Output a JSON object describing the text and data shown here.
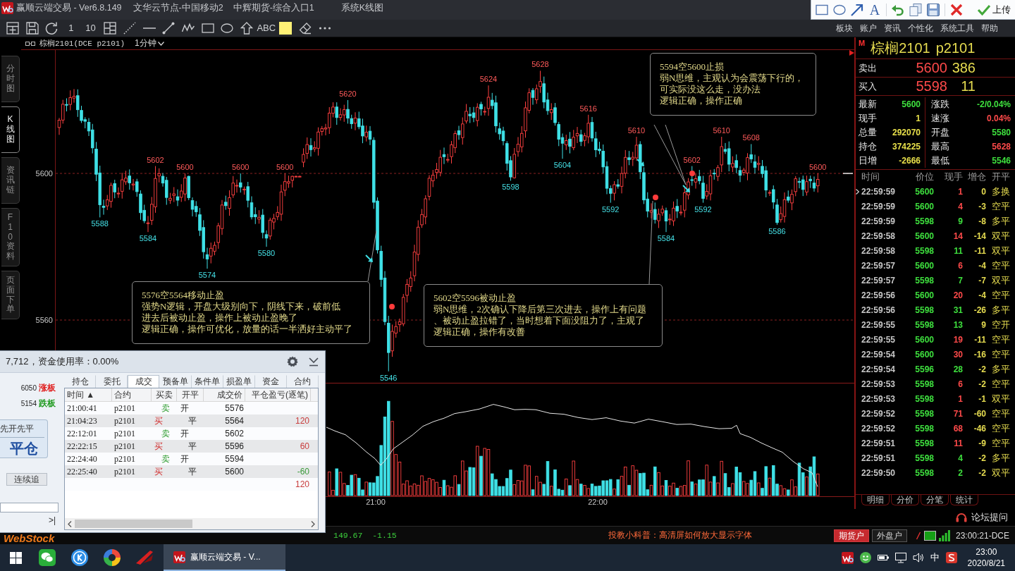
{
  "title_bar": {
    "title": "赢顺云端交易 - Ver6.8.149",
    "items": [
      "文华云节点-中国移动2",
      "中辉期货-综合入口1",
      "系统K线图"
    ]
  },
  "snip_toolbar": {
    "tools": [
      {
        "kind": "rectangle"
      },
      {
        "kind": "ellipse"
      },
      {
        "kind": "arrow"
      },
      {
        "kind": "text",
        "label": "A"
      },
      {
        "kind": "undo"
      },
      {
        "kind": "copy"
      },
      {
        "kind": "save"
      },
      {
        "kind": "close"
      },
      {
        "kind": "upload",
        "label": "上传"
      }
    ]
  },
  "toolbar": {
    "tools": [
      {
        "kind": "frame"
      },
      {
        "kind": "save"
      },
      {
        "kind": "refresh"
      },
      {
        "kind": "text",
        "label": "1"
      },
      {
        "kind": "text",
        "label": "10"
      },
      {
        "kind": "layout"
      },
      {
        "kind": "dotted-line"
      },
      {
        "kind": "horizontal-line"
      },
      {
        "kind": "segment"
      },
      {
        "kind": "wave"
      },
      {
        "kind": "rectangle"
      },
      {
        "kind": "ellipse"
      },
      {
        "kind": "up-arrow"
      },
      {
        "kind": "text",
        "label": "ABC"
      },
      {
        "kind": "swatch",
        "color": "#fff176"
      },
      {
        "kind": "eraser"
      },
      {
        "kind": "more"
      }
    ],
    "menu": [
      "板块",
      "账户",
      "资讯",
      "个性化",
      "系统工具",
      "帮助"
    ]
  },
  "side_tabs": [
    {
      "label": "分时图",
      "selected": false
    },
    {
      "label": "K线图",
      "selected": true
    },
    {
      "label": "资讯链",
      "selected": false
    },
    {
      "label": "F10资料",
      "selected": false
    },
    {
      "label": "页面下单",
      "selected": false
    }
  ],
  "chart": {
    "symbol": "棕榈2101(DCE p2101)",
    "period": "1分钟",
    "y_labels": [
      "5600",
      "5560"
    ],
    "time_labels": [
      "21:00",
      "22:00"
    ],
    "price_labels": [
      {
        "text": "5588",
        "kind": "low"
      },
      {
        "text": "5584",
        "kind": "low"
      },
      {
        "text": "5602",
        "kind": "high"
      },
      {
        "text": "5600",
        "kind": "high"
      },
      {
        "text": "5574",
        "kind": "low"
      },
      {
        "text": "5600",
        "kind": "high"
      },
      {
        "text": "5580",
        "kind": "low"
      },
      {
        "text": "5600",
        "kind": "high"
      },
      {
        "text": "5620",
        "kind": "high"
      },
      {
        "text": "5546",
        "kind": "low"
      },
      {
        "text": "5624",
        "kind": "high"
      },
      {
        "text": "5598",
        "kind": "low"
      },
      {
        "text": "5628",
        "kind": "high"
      },
      {
        "text": "5604",
        "kind": "low"
      },
      {
        "text": "5616",
        "kind": "high"
      },
      {
        "text": "5592",
        "kind": "low"
      },
      {
        "text": "5610",
        "kind": "high"
      },
      {
        "text": "5584",
        "kind": "low"
      },
      {
        "text": "5602",
        "kind": "high"
      },
      {
        "text": "5592",
        "kind": "low"
      },
      {
        "text": "5610",
        "kind": "high"
      },
      {
        "text": "5608",
        "kind": "high"
      },
      {
        "text": "5586",
        "kind": "low"
      },
      {
        "text": "5600",
        "kind": "high"
      }
    ],
    "markers": [
      {
        "kind": "arrow"
      },
      {
        "kind": "dot"
      },
      {
        "kind": "arrow"
      },
      {
        "kind": "dot"
      },
      {
        "kind": "arrow"
      },
      {
        "kind": "dot"
      }
    ],
    "notes": [
      {
        "lines": [
          "5576空5564移动止盈",
          "强势N逻辑，开盘大级别向下，阴线下来，破前低",
          "进去后被动止盈，操作上被动止盈晚了",
          "逻辑正确，操作可优化，放量的话一半洒好主动平了"
        ]
      },
      {
        "lines": [
          "5602空5596被动止盈",
          "弱N思维，2次确认下降后第三次进去，操作上有问题",
          "、被动止盈拉错了，当时想着下面没阻力了，主观了",
          "逻辑正确，操作有改善"
        ]
      },
      {
        "lines": [
          "5594空5600止损",
          "弱N思维，主观认为会震荡下行的，",
          "可实际没这么走，没办法",
          "逻辑正确，操作正确"
        ]
      }
    ]
  },
  "quote": {
    "badge": "M",
    "name": "棕榈2101",
    "code": "p2101",
    "ask": {
      "label": "卖出",
      "price": "5600",
      "volume": "386"
    },
    "bid": {
      "label": "买入",
      "price": "5598",
      "volume": "11"
    },
    "stats": [
      {
        "label": "最新",
        "value": "5600",
        "color": "#3ee03e"
      },
      {
        "label": "涨跌",
        "value": "-2/0.04%",
        "color": "#3ee03e"
      },
      {
        "label": "现手",
        "value": "1",
        "color": "#e8e04a"
      },
      {
        "label": "速涨",
        "value": "0.04%",
        "color": "#ff4a4a"
      },
      {
        "label": "总量",
        "value": "292070",
        "color": "#e8e04a"
      },
      {
        "label": "开盘",
        "value": "5580",
        "color": "#3ee03e"
      },
      {
        "label": "持仓",
        "value": "374225",
        "color": "#e8e04a"
      },
      {
        "label": "最高",
        "value": "5628",
        "color": "#ff4a4a"
      },
      {
        "label": "日增",
        "value": "-2666",
        "color": "#e8e04a"
      },
      {
        "label": "最低",
        "value": "5546",
        "color": "#3ee03e"
      }
    ]
  },
  "ticks": {
    "columns": [
      "时间",
      "价位",
      "现手",
      "增仓",
      "开平"
    ],
    "rows": [
      {
        "time": "22:59:59",
        "price": "5600",
        "volume": "1",
        "color": "#ff4a4a",
        "change": "0",
        "type": "多换",
        "current": true
      },
      {
        "time": "22:59:59",
        "price": "5600",
        "volume": "4",
        "color": "#ff4a4a",
        "change": "-3",
        "type": "空平",
        "current": false
      },
      {
        "time": "22:59:59",
        "price": "5598",
        "volume": "9",
        "color": "#3ee03e",
        "change": "-8",
        "type": "多平",
        "current": false
      },
      {
        "time": "22:59:58",
        "price": "5600",
        "volume": "14",
        "color": "#ff4a4a",
        "change": "-14",
        "type": "双平",
        "current": false
      },
      {
        "time": "22:59:58",
        "price": "5598",
        "volume": "11",
        "color": "#3ee03e",
        "change": "-11",
        "type": "双平",
        "current": false
      },
      {
        "time": "22:59:57",
        "price": "5600",
        "volume": "6",
        "color": "#ff4a4a",
        "change": "-4",
        "type": "空平",
        "current": false
      },
      {
        "time": "22:59:57",
        "price": "5598",
        "volume": "7",
        "color": "#3ee03e",
        "change": "-7",
        "type": "双平",
        "current": false
      },
      {
        "time": "22:59:56",
        "price": "5600",
        "volume": "20",
        "color": "#ff4a4a",
        "change": "-4",
        "type": "空平",
        "current": false
      },
      {
        "time": "22:59:56",
        "price": "5598",
        "volume": "31",
        "color": "#3ee03e",
        "change": "-26",
        "type": "多平",
        "current": false
      },
      {
        "time": "22:59:55",
        "price": "5598",
        "volume": "13",
        "color": "#3ee03e",
        "change": "9",
        "type": "空开",
        "current": false
      },
      {
        "time": "22:59:55",
        "price": "5600",
        "volume": "19",
        "color": "#ff4a4a",
        "change": "-11",
        "type": "空平",
        "current": false
      },
      {
        "time": "22:59:54",
        "price": "5600",
        "volume": "30",
        "color": "#ff4a4a",
        "change": "-16",
        "type": "空平",
        "current": false
      },
      {
        "time": "22:59:54",
        "price": "5596",
        "volume": "28",
        "color": "#3ee03e",
        "change": "-2",
        "type": "多平",
        "current": false
      },
      {
        "time": "22:59:53",
        "price": "5598",
        "volume": "6",
        "color": "#ff4a4a",
        "change": "-2",
        "type": "空平",
        "current": false
      },
      {
        "time": "22:59:53",
        "price": "5598",
        "volume": "1",
        "color": "#ff4a4a",
        "change": "-1",
        "type": "双平",
        "current": false
      },
      {
        "time": "22:59:52",
        "price": "5598",
        "volume": "71",
        "color": "#ff4a4a",
        "change": "-60",
        "type": "空平",
        "current": false
      },
      {
        "time": "22:59:52",
        "price": "5598",
        "volume": "68",
        "color": "#ff4a4a",
        "change": "-46",
        "type": "空平",
        "current": false
      },
      {
        "time": "22:59:51",
        "price": "5598",
        "volume": "11",
        "color": "#ff4a4a",
        "change": "-9",
        "type": "空平",
        "current": false
      },
      {
        "time": "22:59:51",
        "price": "5598",
        "volume": "4",
        "color": "#3ee03e",
        "change": "-2",
        "type": "多平",
        "current": false
      },
      {
        "time": "22:59:50",
        "price": "5598",
        "volume": "2",
        "color": "#3ee03e",
        "change": "-2",
        "type": "双平",
        "current": false
      }
    ]
  },
  "tick_tabs": [
    "明细",
    "分价",
    "分笔",
    "统计"
  ],
  "forum_link": "论坛提问",
  "order_window": {
    "summary": "7,712，资金使用率：0.00%",
    "limits": [
      {
        "price": "6050",
        "label": "涨板",
        "color": "#e02020"
      },
      {
        "price": "5154",
        "label": "跌板",
        "color": "#1e9a1e"
      }
    ],
    "mode": "先开先平",
    "action": "平仓",
    "chase_button": "连续追",
    "end_button": ">|",
    "tabs": [
      {
        "label": "持仓",
        "selected": false
      },
      {
        "label": "委托",
        "selected": false
      },
      {
        "label": "成交",
        "selected": true
      },
      {
        "label": "预备单",
        "selected": false
      },
      {
        "label": "条件单",
        "selected": false
      },
      {
        "label": "损盈单",
        "selected": false
      },
      {
        "label": "资金",
        "selected": false
      },
      {
        "label": "合约",
        "selected": false
      }
    ],
    "columns": [
      "时间 ▲",
      "合约",
      "买卖",
      "开平",
      "成交价",
      "平仓盈亏(逐笔)"
    ],
    "rows": [
      {
        "time": "21:00:41",
        "contract": "p2101",
        "side": {
          "label": "卖",
          "kind": "sell"
        },
        "offset": {
          "label": "开",
          "kind": "open"
        },
        "price": "5576"
      },
      {
        "time": "21:04:23",
        "contract": "p2101",
        "side": {
          "label": "买",
          "kind": "buy"
        },
        "offset": {
          "label": "平",
          "kind": "close"
        },
        "price": "5564",
        "pnl": "120",
        "color": "#c83c3c"
      },
      {
        "time": "22:12:01",
        "contract": "p2101",
        "side": {
          "label": "卖",
          "kind": "sell"
        },
        "offset": {
          "label": "开",
          "kind": "open"
        },
        "price": "5602"
      },
      {
        "time": "22:22:15",
        "contract": "p2101",
        "side": {
          "label": "买",
          "kind": "buy"
        },
        "offset": {
          "label": "平",
          "kind": "close"
        },
        "price": "5596",
        "pnl": "60",
        "color": "#c83c3c"
      },
      {
        "time": "22:24:40",
        "contract": "p2101",
        "side": {
          "label": "卖",
          "kind": "sell"
        },
        "offset": {
          "label": "开",
          "kind": "open"
        },
        "price": "5594"
      },
      {
        "time": "22:25:40",
        "contract": "p2101",
        "side": {
          "label": "买",
          "kind": "buy"
        },
        "offset": {
          "label": "平",
          "kind": "close"
        },
        "price": "5600",
        "pnl": "-60",
        "color": "#3a9a3a"
      }
    ],
    "total": {
      "pnl": "120",
      "color": "#c83c3c"
    }
  },
  "status_bar": {
    "logo": "WebStock",
    "quote": "149.67  -1.15",
    "notice": "投教小科普：高清屏如何放大显示字体",
    "accounts": [
      {
        "label": "期货户",
        "selected": true
      },
      {
        "label": "外盘户",
        "selected": false
      }
    ],
    "clock": "23:00:21-DCE"
  },
  "taskbar": {
    "apps": [
      {
        "kind": "chat"
      },
      {
        "kind": "k-app"
      },
      {
        "kind": "ring-app"
      },
      {
        "kind": "red-app"
      }
    ],
    "active_window": "赢顺云端交易 - V...",
    "ime": "中",
    "time": "23:00",
    "date": "2020/8/21"
  }
}
